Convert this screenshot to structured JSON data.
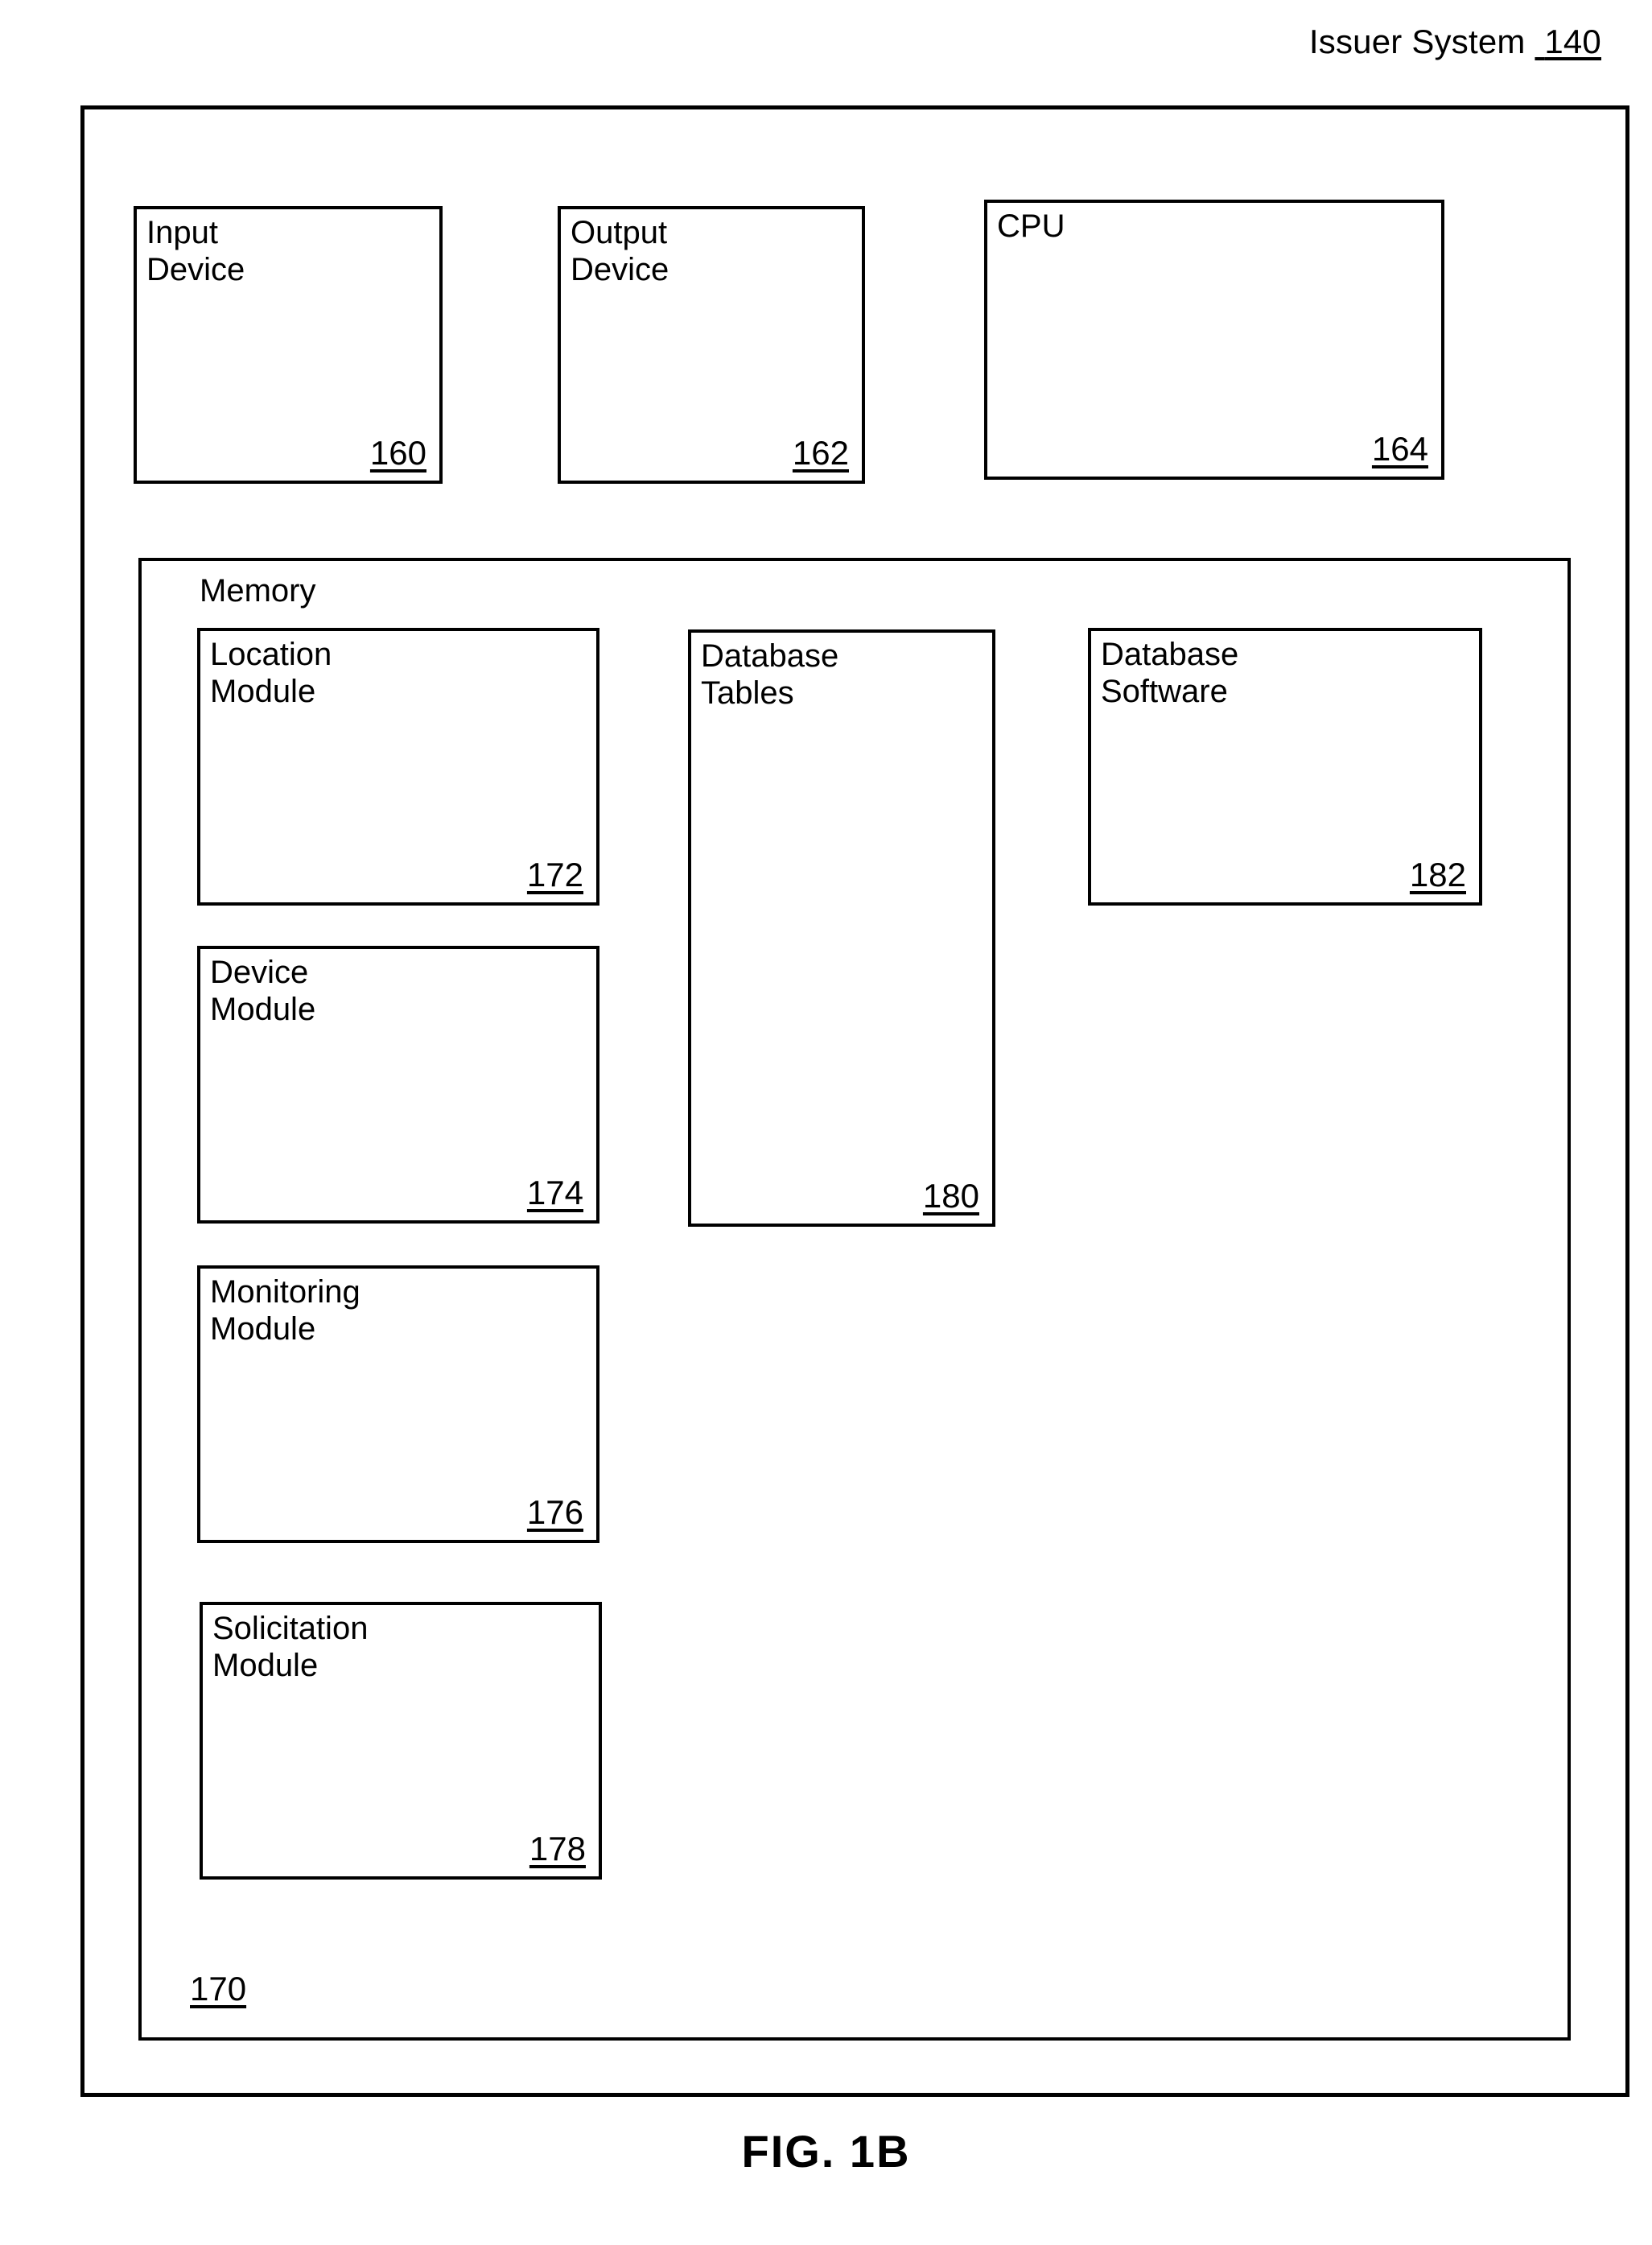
{
  "figure": {
    "caption": "FIG. 1B",
    "system_title_text": "Issuer System",
    "system_title_ref": "140"
  },
  "hardware_boxes": [
    {
      "label": "Input\nDevice",
      "ref": "160"
    },
    {
      "label": "Output\nDevice",
      "ref": "162"
    },
    {
      "label": "CPU",
      "ref": "164"
    }
  ],
  "memory": {
    "heading": "Memory",
    "ref": "170",
    "modules": [
      {
        "label": "Location\nModule",
        "ref": "172"
      },
      {
        "label": "Device\nModule",
        "ref": "174"
      },
      {
        "label": "Monitoring\nModule",
        "ref": "176"
      },
      {
        "label": "Solicitation\nModule",
        "ref": "178"
      }
    ],
    "data_boxes": [
      {
        "label": "Database\nTables",
        "ref": "180"
      },
      {
        "label": "Database\nSoftware",
        "ref": "182"
      }
    ]
  },
  "colors": {
    "line": "#000000",
    "background": "#ffffff",
    "text": "#000000"
  }
}
